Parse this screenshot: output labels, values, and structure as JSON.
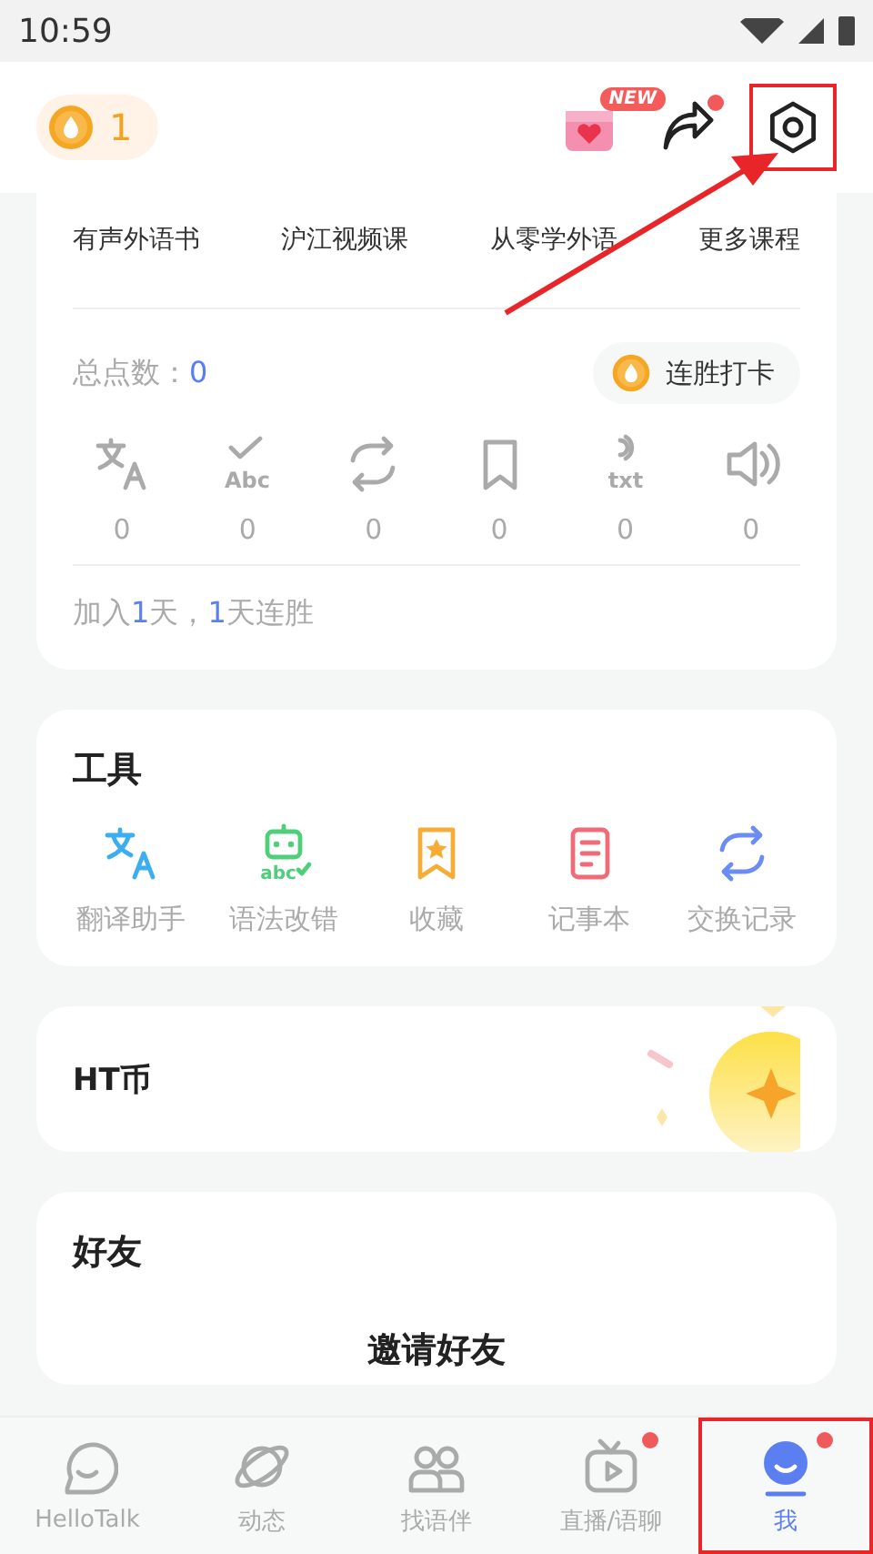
{
  "status_bar": {
    "time": "10:59"
  },
  "header": {
    "streak_count": "1",
    "gift_badge": "NEW",
    "share_dot": true,
    "settings_highlighted": true
  },
  "courses": [
    "有声外语书",
    "沪江视频课",
    "从零学外语",
    "更多课程"
  ],
  "stats": {
    "label": "总点数：",
    "value": "0",
    "checkin_button": "连胜打卡",
    "items": [
      {
        "kind": "translate",
        "count": "0"
      },
      {
        "kind": "grammar",
        "icon_text": "Abc",
        "count": "0"
      },
      {
        "kind": "exchange",
        "count": "0"
      },
      {
        "kind": "bookmark",
        "count": "0"
      },
      {
        "kind": "voice_text",
        "icon_text": "txt",
        "count": "0"
      },
      {
        "kind": "speaker",
        "count": "0"
      }
    ]
  },
  "join": {
    "prefix": "加入",
    "days": "1",
    "middle": "天，",
    "streak": "1",
    "suffix": "天连胜"
  },
  "tools": {
    "title": "工具",
    "items": [
      {
        "kind": "translate",
        "label": "翻译助手",
        "color": "#3aaef0"
      },
      {
        "kind": "grammar_bot",
        "icon_text": "abc",
        "label": "语法改错",
        "color": "#4fcf7a"
      },
      {
        "kind": "favorite",
        "label": "收藏",
        "color": "#f5ad35"
      },
      {
        "kind": "notebook",
        "label": "记事本",
        "color": "#f06b78"
      },
      {
        "kind": "exchange",
        "label": "交换记录",
        "color": "#6a8cf5"
      }
    ]
  },
  "ht_coin": {
    "title": "HT币"
  },
  "friends": {
    "title": "好友",
    "invite": "邀请好友"
  },
  "nav": [
    {
      "kind": "chat",
      "label": "HelloTalk",
      "selected": false,
      "badge": false,
      "highlighted": false
    },
    {
      "kind": "planet",
      "label": "动态",
      "selected": false,
      "badge": false,
      "highlighted": false
    },
    {
      "kind": "partners",
      "label": "找语伴",
      "selected": false,
      "badge": false,
      "highlighted": false
    },
    {
      "kind": "live",
      "label": "直播/语聊",
      "selected": false,
      "badge": true,
      "highlighted": false
    },
    {
      "kind": "me",
      "label": "我",
      "selected": true,
      "badge": true,
      "highlighted": true
    }
  ]
}
